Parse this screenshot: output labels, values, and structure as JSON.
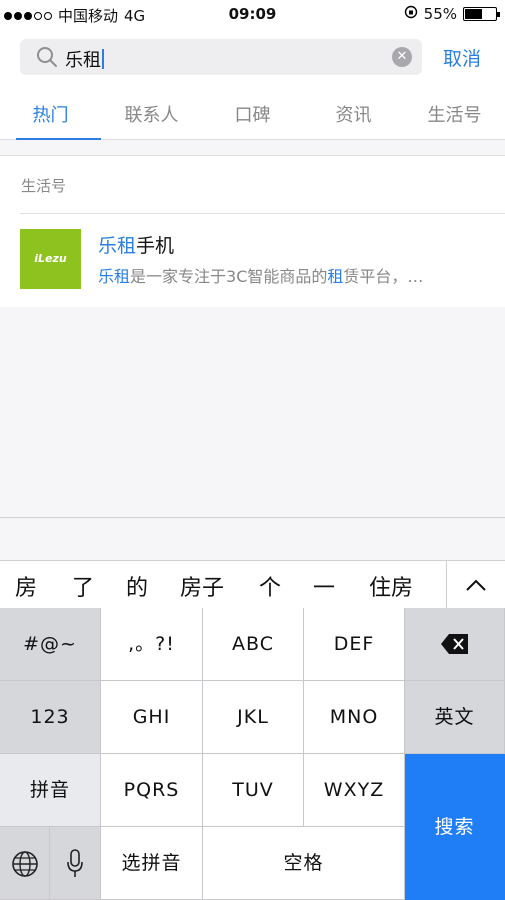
{
  "status": {
    "carrier": "中国移动",
    "network": "4G",
    "time": "09:09",
    "battery": "55%",
    "battery_level": 0.55
  },
  "search": {
    "query": "乐租",
    "cancel_label": "取消"
  },
  "tabs": [
    {
      "label": "热门"
    },
    {
      "label": "联系人"
    },
    {
      "label": "口碑"
    },
    {
      "label": "资讯"
    },
    {
      "label": "生活号"
    }
  ],
  "results": {
    "section_label": "生活号",
    "item": {
      "logo_text": "iLezu",
      "title_hl": "乐租",
      "title_rest": "手机",
      "desc_parts": [
        "乐租",
        "是一家专注于3C智能商品的",
        "租",
        "赁平台，…"
      ]
    }
  },
  "candidates": [
    "房",
    "了",
    "的",
    "房子",
    "个",
    "一",
    "住房"
  ],
  "keyboard": {
    "symbols": "#@~",
    "punct": ",。?!",
    "abc": "ABC",
    "def": "DEF",
    "num": "123",
    "ghi": "GHI",
    "jkl": "JKL",
    "mno": "MNO",
    "english": "英文",
    "pinyin": "拼音",
    "pqrs": "PQRS",
    "tuv": "TUV",
    "wxyz": "WXYZ",
    "search": "搜索",
    "select_pinyin": "选拼音",
    "space": "空格"
  }
}
